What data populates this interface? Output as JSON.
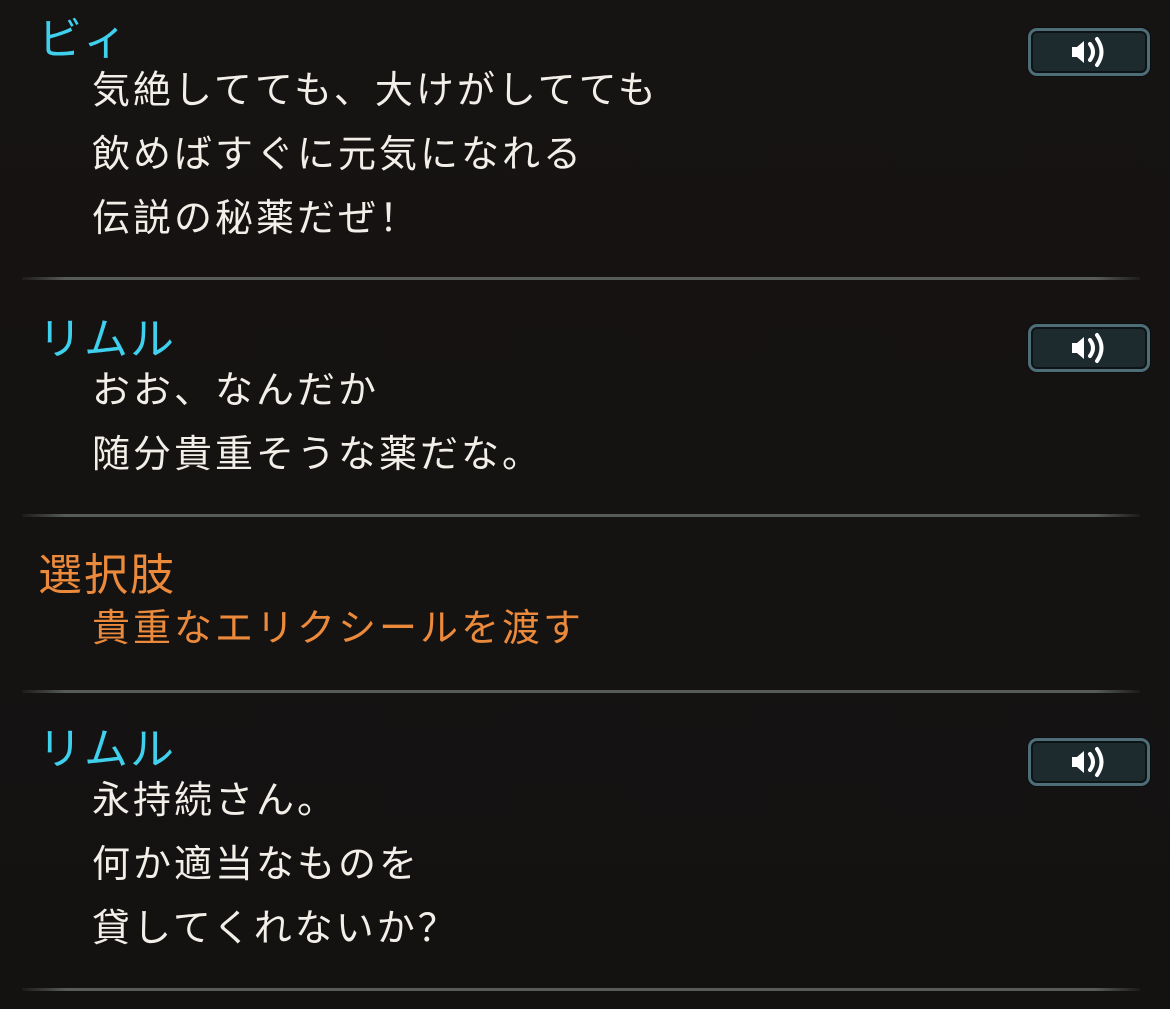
{
  "entries": [
    {
      "speaker": "ビィ",
      "type": "dialogue",
      "has_voice": true,
      "lines": [
        "気絶してても、大けがしてても",
        "飲めばすぐに元気になれる",
        "伝説の秘薬だぜ！"
      ]
    },
    {
      "speaker": "リムル",
      "type": "dialogue",
      "has_voice": true,
      "lines": [
        "おお、なんだか",
        "随分貴重そうな薬だな。"
      ]
    },
    {
      "speaker": "選択肢",
      "type": "choice",
      "has_voice": false,
      "lines": [
        "貴重なエリクシールを渡す"
      ]
    },
    {
      "speaker": "リムル",
      "type": "dialogue",
      "has_voice": true,
      "lines": [
        "永持続さん。",
        "何か適当なものを",
        "貸してくれないか？"
      ]
    }
  ],
  "icons": {
    "voice_button": "speaker-sound-icon"
  },
  "colors": {
    "speaker_name": "#3fd0ee",
    "choice": "#ec8a3c",
    "text": "#f2eee8",
    "background": "#151212"
  }
}
